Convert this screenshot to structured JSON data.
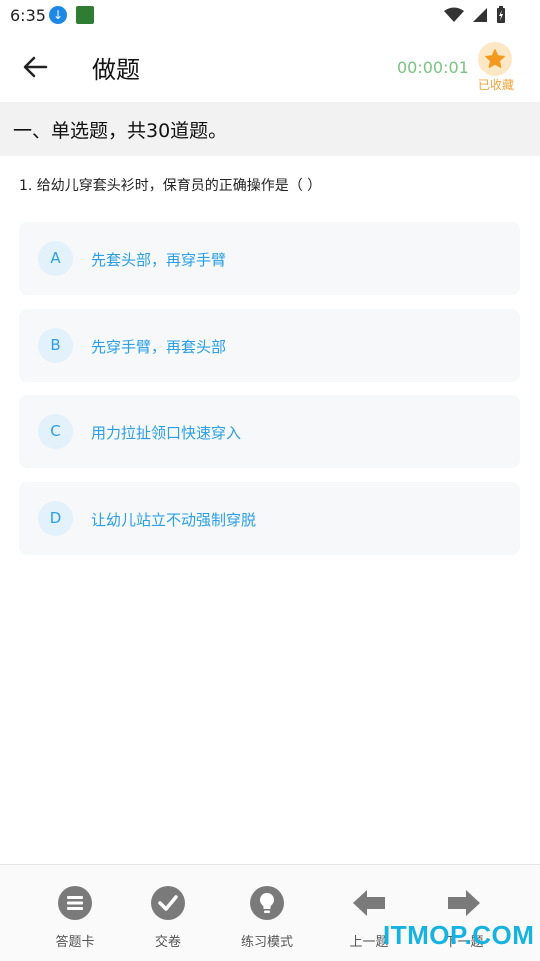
{
  "status_bar": {
    "time": "6:35",
    "download_icon": "download-icon",
    "app_icon": "app-notification-icon",
    "wifi_icon": "wifi-icon",
    "signal_icon": "signal-icon",
    "battery_icon": "battery-charging-icon"
  },
  "header": {
    "title": "做题",
    "timer": "00:00:01",
    "favorite_label": "已收藏",
    "accent_color": "#f0a43a"
  },
  "section": {
    "title": "一、单选题，共30道题。"
  },
  "question": {
    "text": "1. 给幼儿穿套头衫时，保育员的正确操作是（ ）"
  },
  "options": [
    {
      "key": "A",
      "text": "先套头部，再穿手臂"
    },
    {
      "key": "B",
      "text": "先穿手臂，再套头部"
    },
    {
      "key": "C",
      "text": "用力拉扯领口快速穿入"
    },
    {
      "key": "D",
      "text": "让幼儿站立不动强制穿脱"
    }
  ],
  "bottom_nav": [
    {
      "label": "答题卡",
      "icon": "answer-card-icon"
    },
    {
      "label": "交卷",
      "icon": "submit-check-icon"
    },
    {
      "label": "练习模式",
      "icon": "lightbulb-icon"
    },
    {
      "label": "上一题",
      "icon": "arrow-left-icon"
    },
    {
      "label": "下一题",
      "icon": "arrow-right-icon"
    }
  ],
  "watermark": "ITMOP.COM",
  "colors": {
    "option_text": "#2b9fe7",
    "timer": "#79c480",
    "nav_icon": "#7a7a7a"
  }
}
